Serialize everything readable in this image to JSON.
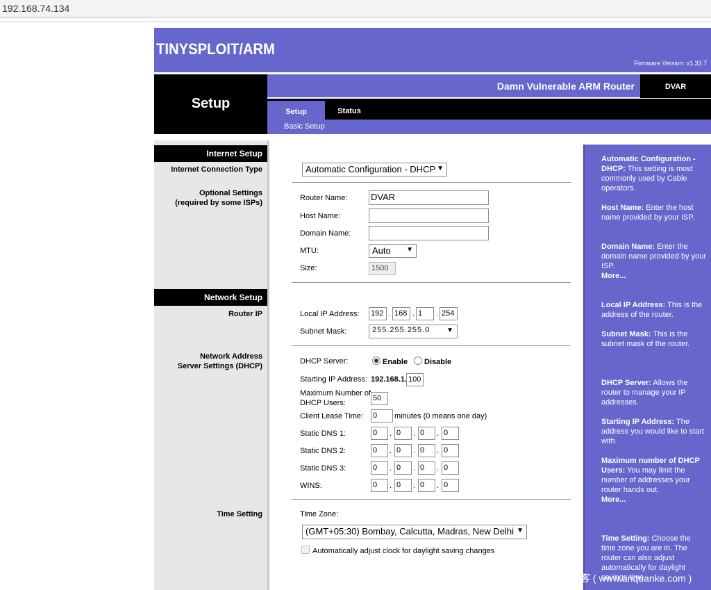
{
  "browser": {
    "address": "192.168.74.134"
  },
  "header": {
    "logo": "TINYSPLOIT/ARM",
    "firmware": "Firmware Version: v1.33.7",
    "router_title": "Damn Vulnerable ARM Router",
    "model": "DVAR",
    "section_title": "Setup"
  },
  "tabs": [
    {
      "label": "Setup"
    },
    {
      "label": "Status"
    }
  ],
  "subnav": {
    "item": "Basic Setup"
  },
  "left": {
    "internet_setup": "Internet Setup",
    "connection_type": "Internet Connection Type",
    "optional_1": "Optional Settings",
    "optional_2": "(required by some ISPs)",
    "network_setup": "Network Setup",
    "router_ip": "Router IP",
    "nas_1": "Network Address",
    "nas_2": "Server Settings (DHCP)",
    "time_setting": "Time Setting"
  },
  "form": {
    "connection_type": "Automatic Configuration - DHCP",
    "router_name_label": "Router Name:",
    "router_name": "DVAR",
    "host_name_label": "Host Name:",
    "host_name": "",
    "domain_name_label": "Domain Name:",
    "domain_name": "",
    "mtu_label": "MTU:",
    "mtu": "Auto",
    "size_label": "Size:",
    "size": "1500",
    "local_ip_label": "Local IP Address:",
    "local_ip": [
      "192",
      "168",
      "1",
      "254"
    ],
    "subnet_label": "Subnet Mask:",
    "subnet": "255.255.255.0",
    "dhcp_label": "DHCP Server:",
    "dhcp_enable": "Enable",
    "dhcp_disable": "Disable",
    "dhcp_selected": "Enable",
    "start_ip_label": "Starting IP Address:",
    "start_ip_prefix": "192.168.1.",
    "start_ip_last": "100",
    "max_users_label_1": "Maximum Number of",
    "max_users_label_2": "DHCP Users:",
    "max_users": "50",
    "lease_label": "Client Lease Time:",
    "lease": "0",
    "lease_suffix": "minutes (0 means one day)",
    "dns1_label": "Static DNS 1:",
    "dns1": [
      "0",
      "0",
      "0",
      "0"
    ],
    "dns2_label": "Static DNS 2:",
    "dns2": [
      "0",
      "0",
      "0",
      "0"
    ],
    "dns3_label": "Static DNS 3:",
    "dns3": [
      "0",
      "0",
      "0",
      "0"
    ],
    "wins_label": "WINS:",
    "wins": [
      "0",
      "0",
      "0",
      "0"
    ],
    "tz_label": "Time Zone:",
    "timezone": "(GMT+05:30) Bombay, Calcutta, Madras, New Delhi",
    "dst_label": "Automatically adjust clock for daylight saving changes",
    "dst_checked": false
  },
  "help": {
    "auto_title": "Automatic Configuration - DHCP:",
    "auto_text": " This setting is most commonly used by Cable operators.",
    "host_title": "Host Name:",
    "host_text": " Enter the host name provided by your ISP.",
    "domain_title": "Domain Name:",
    "domain_text": " Enter the domain name provided by your ISP.",
    "more1": "More...",
    "lip_title": "Local IP Address:",
    "lip_text": " This is the address of the router.",
    "mask_title": "Subnet Mask:",
    "mask_text": " This is the subnet mask of the router.",
    "dhcp_title": "DHCP Server:",
    "dhcp_text": " Allows the router to manage your IP addresses.",
    "sip_title": "Starting IP Address:",
    "sip_text": " The address you would like to start with.",
    "max_title": "Maximum number of DHCP Users:",
    "max_text": " You may limit the number of addresses your router hands out.",
    "more2": "More...",
    "time_title": "Time Setting:",
    "time_text": " Choose the time zone you are in. The router can also adjust automatically for daylight savings time."
  },
  "watermark": "客 ( www.anquanke.com )",
  "colors": {
    "purple": "#6666cc",
    "black": "#000000",
    "panel_gray": "#e7e7e7"
  }
}
